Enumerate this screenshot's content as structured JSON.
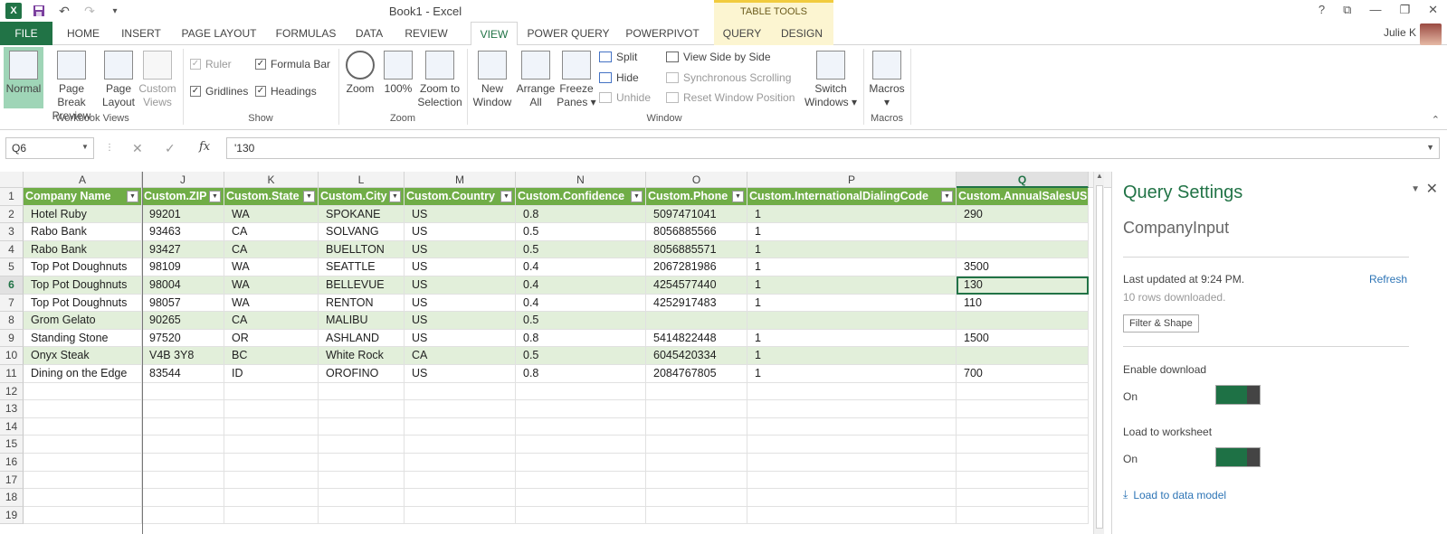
{
  "titlebar": {
    "title": "Book1 - Excel",
    "contextual_band": "TABLE TOOLS",
    "win_controls": [
      "?",
      "⧉",
      "—",
      "❐",
      "✕"
    ]
  },
  "tabs": {
    "file": "FILE",
    "items": [
      "HOME",
      "INSERT",
      "PAGE LAYOUT",
      "FORMULAS",
      "DATA",
      "REVIEW",
      "VIEW",
      "POWER QUERY",
      "POWERPIVOT",
      "QUERY",
      "DESIGN"
    ],
    "active": "VIEW",
    "user": "Julie K"
  },
  "ribbon": {
    "normal": "Normal",
    "page_break_1": "Page Break",
    "page_break_2": "Preview",
    "page_layout_1": "Page",
    "page_layout_2": "Layout",
    "custom_views_1": "Custom",
    "custom_views_2": "Views",
    "group_workbook_views": "Workbook Views",
    "ruler": "Ruler",
    "formula_bar": "Formula Bar",
    "gridlines": "Gridlines",
    "headings": "Headings",
    "group_show": "Show",
    "zoom": "Zoom",
    "zoom100": "100%",
    "zoom_sel_1": "Zoom to",
    "zoom_sel_2": "Selection",
    "group_zoom": "Zoom",
    "new_window_1": "New",
    "new_window_2": "Window",
    "arrange_1": "Arrange",
    "arrange_2": "All",
    "freeze_1": "Freeze",
    "freeze_2": "Panes ▾",
    "split": "Split",
    "hide": "Hide",
    "unhide": "Unhide",
    "side_by_side": "View Side by Side",
    "sync_scroll": "Synchronous Scrolling",
    "reset_pos": "Reset Window Position",
    "switch_1": "Switch",
    "switch_2": "Windows ▾",
    "group_window": "Window",
    "macros_1": "Macros",
    "macros_2": "▾",
    "group_macros": "Macros"
  },
  "formulabar": {
    "namebox": "Q6",
    "formula": "'130"
  },
  "grid": {
    "columns": [
      "A",
      "J",
      "K",
      "L",
      "M",
      "N",
      "O",
      "P",
      "Q"
    ],
    "selected_column": "Q",
    "headers": [
      "Company Name",
      "Custom.ZIP",
      "Custom.State",
      "Custom.City",
      "Custom.Country",
      "Custom.Confidence",
      "Custom.Phone",
      "Custom.InternationalDialingCode",
      "Custom.AnnualSalesUS"
    ],
    "row_numbers": [
      "1",
      "2",
      "3",
      "4",
      "5",
      "6",
      "7",
      "8",
      "9",
      "10",
      "11",
      "12",
      "13",
      "14",
      "15",
      "16",
      "17",
      "18",
      "19"
    ],
    "selected_row": "6",
    "rows": [
      [
        "Hotel Ruby",
        "99201",
        "WA",
        "SPOKANE",
        "US",
        "0.8",
        "5097471041",
        "1",
        "290"
      ],
      [
        "Rabo Bank",
        "93463",
        "CA",
        "SOLVANG",
        "US",
        "0.5",
        "8056885566",
        "1",
        ""
      ],
      [
        "Rabo Bank",
        "93427",
        "CA",
        "BUELLTON",
        "US",
        "0.5",
        "8056885571",
        "1",
        ""
      ],
      [
        "Top Pot Doughnuts",
        "98109",
        "WA",
        "SEATTLE",
        "US",
        "0.4",
        "2067281986",
        "1",
        "3500"
      ],
      [
        "Top Pot Doughnuts",
        "98004",
        "WA",
        "BELLEVUE",
        "US",
        "0.4",
        "4254577440",
        "1",
        "130"
      ],
      [
        "Top Pot Doughnuts",
        "98057",
        "WA",
        "RENTON",
        "US",
        "0.4",
        "4252917483",
        "1",
        "110"
      ],
      [
        "Grom Gelato",
        "90265",
        "CA",
        "MALIBU",
        "US",
        "0.5",
        "",
        "",
        ""
      ],
      [
        "Standing Stone",
        "97520",
        "OR",
        "ASHLAND",
        "US",
        "0.8",
        "5414822448",
        "1",
        "1500"
      ],
      [
        "Onyx Steak",
        "V4B 3Y8",
        "BC",
        "White Rock",
        "CA",
        "0.5",
        "6045420334",
        "1",
        ""
      ],
      [
        "Dining on the Edge",
        "83544",
        "ID",
        "OROFINO",
        "US",
        "0.8",
        "2084767805",
        "1",
        "700"
      ]
    ]
  },
  "query_settings": {
    "title": "Query Settings",
    "query_name": "CompanyInput",
    "last_updated": "Last updated at 9:24 PM.",
    "refresh": "Refresh",
    "rows_downloaded": "10 rows downloaded.",
    "filter_shape": "Filter & Shape",
    "enable_download": "Enable download",
    "enable_download_state": "On",
    "load_to_worksheet": "Load to worksheet",
    "load_to_worksheet_state": "On",
    "load_to_data_model": "Load to data model"
  },
  "colors": {
    "excel_green": "#217346",
    "table_header": "#70ad47",
    "table_band": "#e2efda",
    "link_blue": "#2e75b6"
  }
}
